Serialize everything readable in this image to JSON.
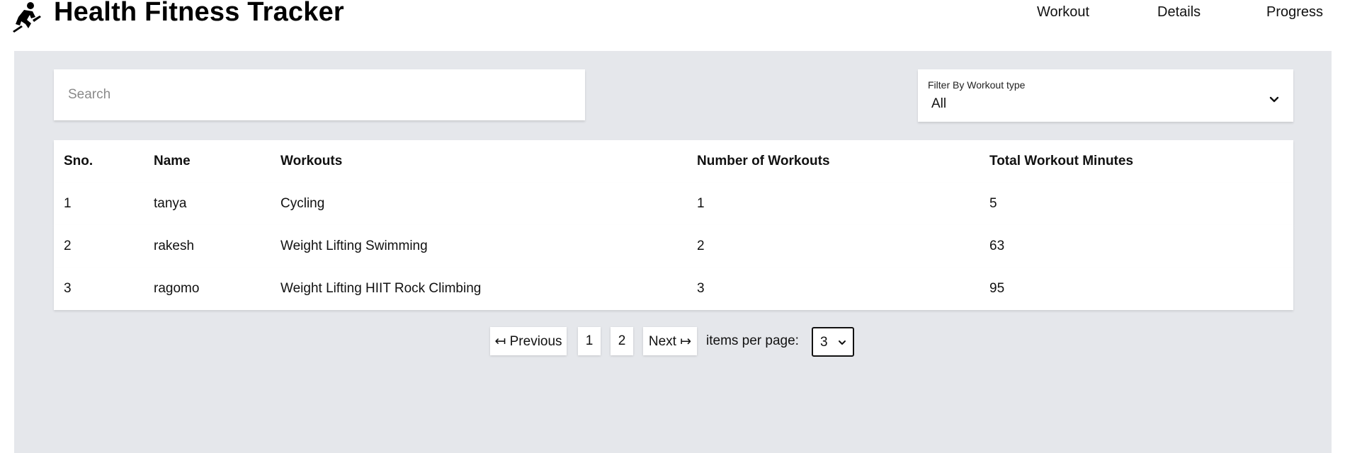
{
  "header": {
    "title": "Health Fitness Tracker",
    "nav": [
      "Workout",
      "Details",
      "Progress"
    ]
  },
  "search": {
    "placeholder": "Search",
    "value": ""
  },
  "filter": {
    "label": "Filter By Workout type",
    "value": "All"
  },
  "table": {
    "columns": [
      "Sno.",
      "Name",
      "Workouts",
      "Number of Workouts",
      "Total Workout Minutes"
    ],
    "rows": [
      [
        "1",
        "tanya",
        "Cycling",
        "1",
        "5"
      ],
      [
        "2",
        "rakesh",
        "Weight Lifting Swimming",
        "2",
        "63"
      ],
      [
        "3",
        "ragomo",
        "Weight Lifting HIIT Rock Climbing",
        "3",
        "95"
      ]
    ]
  },
  "pagination": {
    "previous_label": "↤ Previous",
    "pages": [
      "1",
      "2"
    ],
    "next_label": "Next ↦",
    "per_page_label": "items per page:",
    "per_page_value": "3"
  },
  "icons": {
    "logo": "runner-logo-icon",
    "filter_chevron": "chevron-down-icon",
    "per_page_chevron": "chevron-down-icon"
  }
}
